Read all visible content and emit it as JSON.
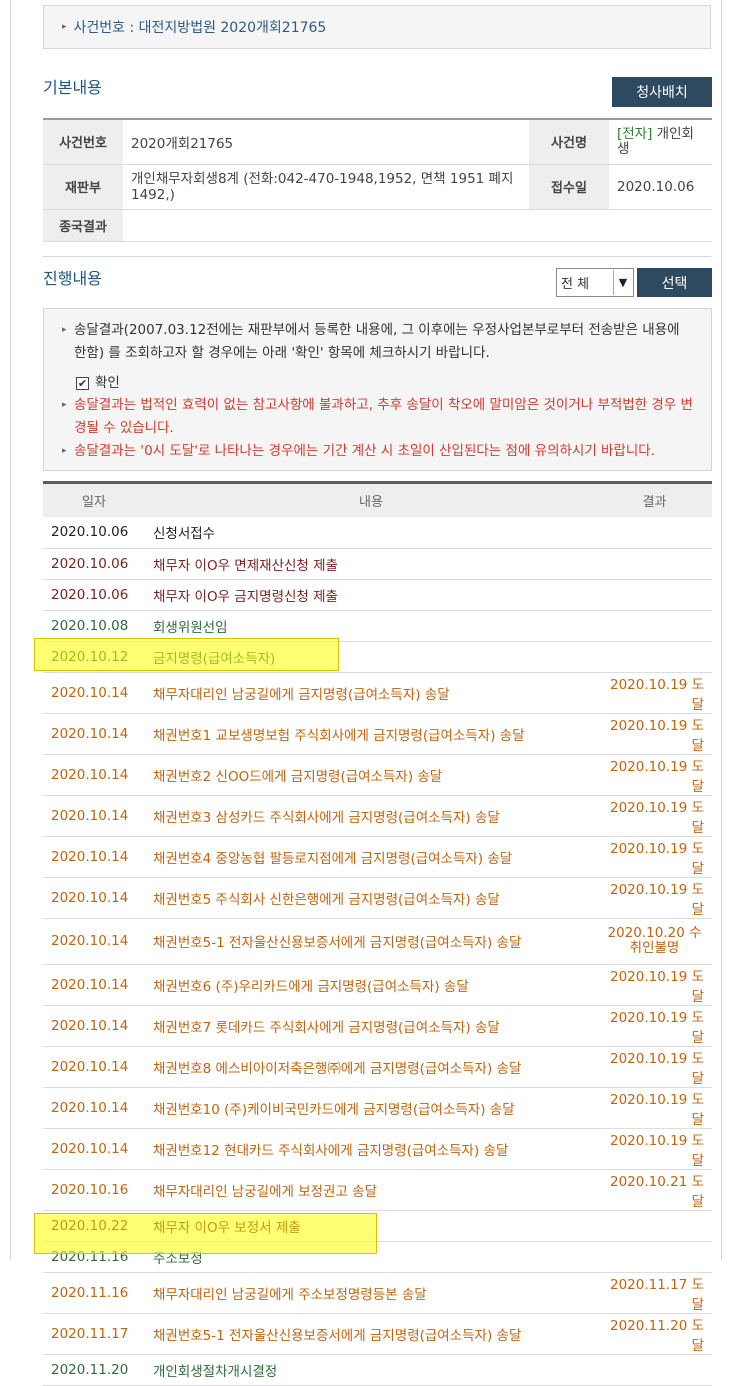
{
  "case_banner": {
    "text": "사건번호 : 대전지방법원 2020개회21765"
  },
  "basic": {
    "title": "기본내용",
    "button": "청사배치",
    "rows": [
      {
        "label1": "사건번호",
        "value1": "2020개회21765",
        "label2": "사건명",
        "value2_tag": "[전자]",
        "value2": " 개인회생"
      },
      {
        "label1": "재판부",
        "value1": "개인채무자회생8계 (전화:042-470-1948,1952, 면책 1951 폐지 1492,)",
        "label2": "접수일",
        "value2": "2020.10.06"
      },
      {
        "label1": "종국결과",
        "value1": ""
      }
    ]
  },
  "progress": {
    "title": "진행내용",
    "filter_value": "전 체",
    "select_button": "선택",
    "notice": {
      "line1": "송달결과(2007.03.12전에는 재판부에서 등록한 내용에, 그 이후에는 우정사업본부로부터 전송받은 내용에 한함) 를 조회하고자 할 경우에는 아래 '확인' 항목에 체크하시기 바랍니다.",
      "checkbox_label": "확인",
      "warn1": "송달결과는 법적인 효력이 없는 참고사항에 불과하고, 추후 송달이 착오에 말미암은 것이거나 부적법한 경우 변경될 수 있습니다.",
      "warn2": "송달결과는 '0시 도달'로 나타나는 경우에는 기간 계산 시 초일이 산입된다는 점에 유의하시기 바랍니다."
    },
    "headers": {
      "date": "일자",
      "content": "내용",
      "result": "결과"
    },
    "rows": [
      {
        "date": "2020.10.06",
        "content": "신청서접수",
        "result": "",
        "color": "black"
      },
      {
        "date": "2020.10.06",
        "content": "채무자 이O우 면제재산신청 제출",
        "result": "",
        "color": "maroon"
      },
      {
        "date": "2020.10.06",
        "content": "채무자 이O우 금지명령신청 제출",
        "result": "",
        "color": "maroon"
      },
      {
        "date": "2020.10.08",
        "content": "회생위원선임",
        "result": "",
        "color": "green"
      },
      {
        "date": "2020.10.12",
        "content": "금지명령(급여소득자)",
        "result": "",
        "color": "green"
      },
      {
        "date": "2020.10.14",
        "content": "채무자대리인 남궁길에게 금지명령(급여소득자) 송달",
        "result": "2020.10.19 도달",
        "color": "orange"
      },
      {
        "date": "2020.10.14",
        "content": "채권번호1 교보생명보험 주식회사에게 금지명령(급여소득자) 송달",
        "result": "2020.10.19 도달",
        "color": "orange"
      },
      {
        "date": "2020.10.14",
        "content": "채권번호2 신OO드에게 금지명령(급여소득자) 송달",
        "result": "2020.10.19 도달",
        "color": "orange"
      },
      {
        "date": "2020.10.14",
        "content": "채권번호3 삼성카드 주식회사에게 금지명령(급여소득자) 송달",
        "result": "2020.10.19 도달",
        "color": "orange"
      },
      {
        "date": "2020.10.14",
        "content": "채권번호4 중앙농협 팔등로지점에게 금지명령(급여소득자) 송달",
        "result": "2020.10.19 도달",
        "color": "orange"
      },
      {
        "date": "2020.10.14",
        "content": "채권번호5 주식회사 신한은행에게 금지명령(급여소득자) 송달",
        "result": "2020.10.19 도달",
        "color": "orange"
      },
      {
        "date": "2020.10.14",
        "content": "채권번호5-1 전자울산신용보증서에게 금지명령(급여소득자) 송달",
        "result": "2020.10.20 수취인불명",
        "color": "orange",
        "tall": true
      },
      {
        "date": "2020.10.14",
        "content": "채권번호6 (주)우리카드에게 금지명령(급여소득자) 송달",
        "result": "2020.10.19 도달",
        "color": "orange"
      },
      {
        "date": "2020.10.14",
        "content": "채권번호7 롯데카드 주식회사에게 금지명령(급여소득자) 송달",
        "result": "2020.10.19 도달",
        "color": "orange"
      },
      {
        "date": "2020.10.14",
        "content": "채권번호8 에스비아이저축은행㈜에게 금지명령(급여소득자) 송달",
        "result": "2020.10.19 도달",
        "color": "orange"
      },
      {
        "date": "2020.10.14",
        "content": "채권번호10 (주)케이비국민카드에게 금지명령(급여소득자) 송달",
        "result": "2020.10.19 도달",
        "color": "orange"
      },
      {
        "date": "2020.10.14",
        "content": "채권번호12 현대카드 주식회사에게 금지명령(급여소득자) 송달",
        "result": "2020.10.19 도달",
        "color": "orange"
      },
      {
        "date": "2020.10.16",
        "content": "채무자대리인 남궁길에게 보정권고 송달",
        "result": "2020.10.21 도달",
        "color": "orange"
      },
      {
        "date": "2020.10.22",
        "content": "채무자 이O우 보정서 제출",
        "result": "",
        "color": "maroon"
      },
      {
        "date": "2020.11.16",
        "content": "주소보정",
        "result": "",
        "color": "green"
      },
      {
        "date": "2020.11.16",
        "content": "채무자대리인 남궁길에게 주소보정명령등본 송달",
        "result": "2020.11.17 도달",
        "color": "orange"
      },
      {
        "date": "2020.11.17",
        "content": "채권번호5-1 전자울산신용보증서에게 금지명령(급여소득자) 송달",
        "result": "2020.11.20 도달",
        "color": "orange"
      },
      {
        "date": "2020.11.20",
        "content": "개인회생절차개시결정",
        "result": "",
        "color": "green"
      }
    ]
  }
}
